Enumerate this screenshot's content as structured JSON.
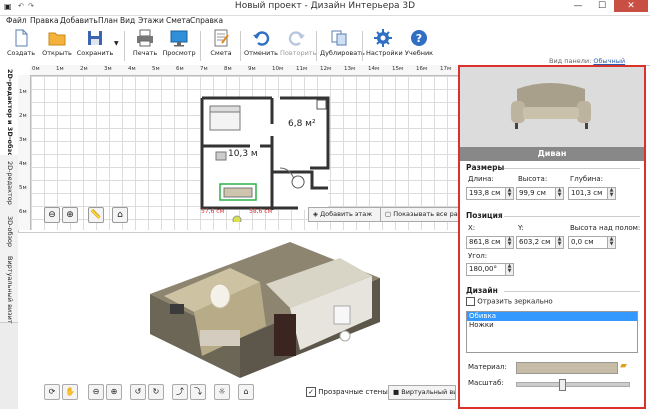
{
  "window": {
    "title": "Новый проект - Дизайн Интерьера 3D",
    "minimize": "—",
    "maximize": "☐",
    "close": "✕"
  },
  "menu": [
    "Файл",
    "Правка",
    "Добавить",
    "План",
    "Вид",
    "Этажи",
    "Смета",
    "Справка"
  ],
  "toolbar": {
    "create": "Создать",
    "open": "Открыть",
    "save": "Сохранить",
    "print": "Печать",
    "preview": "Просмотр",
    "estimate": "Смета",
    "undo": "Отменить",
    "redo": "Повторить",
    "duplicate": "Дублировать",
    "settings": "Настройки",
    "tutorial": "Учебник",
    "view_panel_label": "Вид панели:",
    "view_panel_value": "Обычный"
  },
  "left_tabs": [
    "2D-редактор и 3D-обзор",
    "2D-редактор",
    "3D-обзор",
    "Виртуальный визит"
  ],
  "plan": {
    "ruler_top": [
      "0м",
      "1м",
      "2м",
      "3м",
      "4м",
      "5м",
      "6м",
      "7м",
      "8м",
      "9м",
      "10м",
      "11м",
      "12м",
      "13м",
      "14м",
      "15м",
      "16м",
      "17м"
    ],
    "ruler_left": [
      "1м",
      "2м",
      "3м",
      "4м",
      "5м",
      "6м"
    ],
    "room1_area": "6,8 м²",
    "room2_area": "10,3 м",
    "dim_left": "57,6 см",
    "dim_right": "58,6 см",
    "add_floor": "Добавить этаж",
    "show_all": "Показывать все разм"
  },
  "view3d": {
    "transparent_walls": "Прозрачные стены",
    "virtual_visit": "Виртуальный визит"
  },
  "properties": {
    "item_name": "Диван",
    "sizes_title": "Размеры",
    "length_label": "Длина:",
    "length": "193,8 см",
    "height_label": "Высота:",
    "height": "99,9 см",
    "depth_label": "Глубина:",
    "depth": "101,3 см",
    "position_title": "Позиция",
    "x_label": "X:",
    "x": "861,8 см",
    "y_label": "Y:",
    "y": "603,2 см",
    "floor_height_label": "Высота над полом:",
    "floor_height": "0,0 см",
    "angle_label": "Угол:",
    "angle": "180,00°",
    "design_title": "Дизайн",
    "mirror_label": "Отразить зеркально",
    "parts": [
      "Обивка",
      "Ножки"
    ],
    "material_label": "Материал:",
    "scale_label": "Масштаб:",
    "scale_level": 0.4
  },
  "colors": {
    "accent": "#d9312c",
    "selection": "#3399ff"
  }
}
